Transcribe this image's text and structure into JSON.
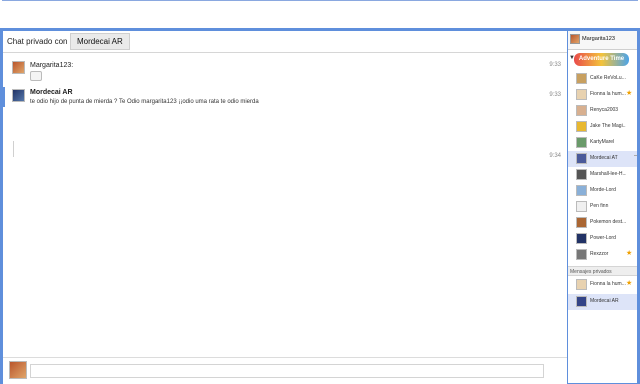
{
  "header": {
    "title": "Chat privado con",
    "chip": "Mordecai AR"
  },
  "messages": [
    {
      "user": "Margarita123:",
      "time": "9:33",
      "text": "",
      "selected": false
    },
    {
      "user": "Mordecai AR",
      "time": "9:33",
      "text": "te odio hijo de punta de mierda  ?  Te Odio margarita123 ¡¡odio uma rata  te odio mierda",
      "selected": true
    },
    {
      "user": "",
      "time": "9:34",
      "text": "",
      "selected": false
    }
  ],
  "composer": {
    "placeholder": ""
  },
  "sidebar": {
    "user": "Margarita123",
    "logo_text": "Adventure Time",
    "contacts": [
      {
        "name": "CaKe ReVoLu...",
        "star": false,
        "color": "#c8a060"
      },
      {
        "name": "Fionna la hum...",
        "star": true,
        "color": "#e8d2b0"
      },
      {
        "name": "Renyca2003",
        "star": false,
        "color": "#d8b090"
      },
      {
        "name": "Jake The Magi...",
        "star": false,
        "color": "#e8b830"
      },
      {
        "name": "KartyMarel",
        "star": false,
        "color": "#6a9a6a"
      },
      {
        "name": "Mordecai AT",
        "star": false,
        "color": "#4a5a9a",
        "active": true
      },
      {
        "name": "Marshall-lee-H...",
        "star": false,
        "color": "#555555"
      },
      {
        "name": "Morde-Lord",
        "star": false,
        "color": "#8ab0d8"
      },
      {
        "name": "Pen finn",
        "star": false,
        "color": "#f0f0f0"
      },
      {
        "name": "Pokemon dest...",
        "star": false,
        "color": "#aa6633"
      },
      {
        "name": "Power-Lord",
        "star": false,
        "color": "#223366"
      },
      {
        "name": "Rexzzor",
        "star": true,
        "color": "#777777"
      }
    ],
    "section_label": "Mensajes privados",
    "private": [
      {
        "name": "Fionna la hum...",
        "star": true,
        "color": "#e8d2b0"
      },
      {
        "name": "Mordecai AR",
        "star": false,
        "color": "#334488",
        "active": true
      }
    ]
  }
}
